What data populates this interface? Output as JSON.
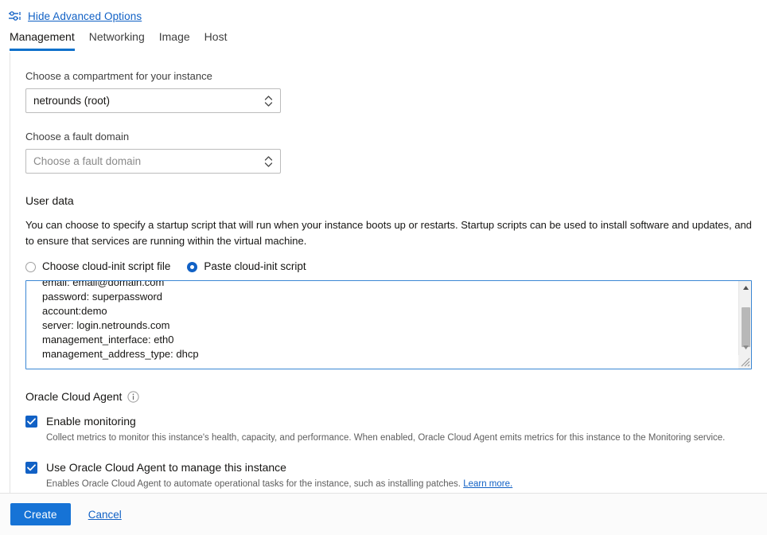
{
  "advanced": {
    "icon": "sliders-icon",
    "link_label": "Hide Advanced Options"
  },
  "tabs": [
    {
      "label": "Management",
      "active": true
    },
    {
      "label": "Networking",
      "active": false
    },
    {
      "label": "Image",
      "active": false
    },
    {
      "label": "Host",
      "active": false
    }
  ],
  "compartment": {
    "label": "Choose a compartment for your instance",
    "value": "netrounds (root)",
    "spinner_icon": "chevron-updown-icon"
  },
  "fault_domain": {
    "label": "Choose a fault domain",
    "placeholder": "Choose a fault domain",
    "value": "",
    "spinner_icon": "chevron-updown-icon"
  },
  "user_data": {
    "title": "User data",
    "description": "You can choose to specify a startup script that will run when your instance boots up or restarts. Startup scripts can be used to install software and updates, and to ensure that services are running within the virtual machine.",
    "radios": [
      {
        "label": "Choose cloud-init script file",
        "checked": false
      },
      {
        "label": "Paste cloud-init script",
        "checked": true
      }
    ],
    "script_lines": [
      "email: email@domain.com",
      "password: superpassword",
      "account:demo",
      "server: login.netrounds.com",
      "management_interface: eth0",
      "management_address_type: dhcp"
    ],
    "script_text": "email: email@domain.com\npassword: superpassword\naccount:demo\nserver: login.netrounds.com\nmanagement_interface: eth0\nmanagement_address_type: dhcp",
    "scrollbar": {
      "up_icon": "triangle-up-icon",
      "down_icon": "triangle-down-icon",
      "thumb": "scrollbar-thumb",
      "resize_icon": "resize-grip-icon"
    }
  },
  "oracle_cloud_agent": {
    "title": "Oracle Cloud Agent",
    "info_icon": "info-icon",
    "options": [
      {
        "label": "Enable monitoring",
        "checked": true,
        "help": "Collect metrics to monitor this instance's health, capacity, and performance. When enabled, Oracle Cloud Agent emits metrics for this instance to the Monitoring service.",
        "help_link": ""
      },
      {
        "label": "Use Oracle Cloud Agent to manage this instance",
        "checked": true,
        "help": "Enables Oracle Cloud Agent to automate operational tasks for the instance, such as installing patches. ",
        "help_link": "Learn more."
      }
    ]
  },
  "footer": {
    "create_label": "Create",
    "cancel_label": "Cancel"
  },
  "colors": {
    "accent_blue": "#1161c5",
    "button_blue": "#1673d6",
    "tab_underline": "#0f71cb",
    "textarea_border": "#3b87d4",
    "border_grey": "#e3e3e3"
  }
}
